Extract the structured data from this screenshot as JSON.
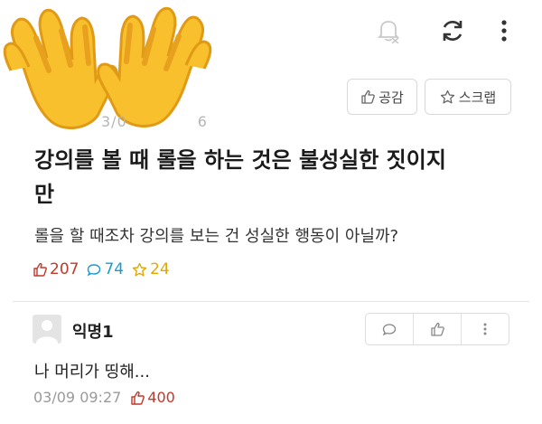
{
  "post": {
    "date_partial": "3/0",
    "date_partial2": "6",
    "title": "강의를 볼 때 롤을 하는 것은 불성실한 짓이지만",
    "body": "롤을 할 때조차 강의를 보는 건 성실한 행동이 아닐까?",
    "stats": {
      "likes": "207",
      "comments": "74",
      "scraps": "24"
    },
    "actions": {
      "like_label": "공감",
      "scrap_label": "스크랩"
    }
  },
  "top_icons": [
    "bell-off-icon",
    "refresh-icon",
    "more-vertical-icon"
  ],
  "comment": {
    "author": "익명1",
    "text": "나 머리가 띵해...",
    "date": "03/09 09:27",
    "likes": "400"
  },
  "colors": {
    "like_red": "#c0392b",
    "comment_blue": "#1a9bd0",
    "scrap_yellow": "#e0a800",
    "hand_yellow": "#f7c02c",
    "hand_outline": "#e09a16"
  }
}
